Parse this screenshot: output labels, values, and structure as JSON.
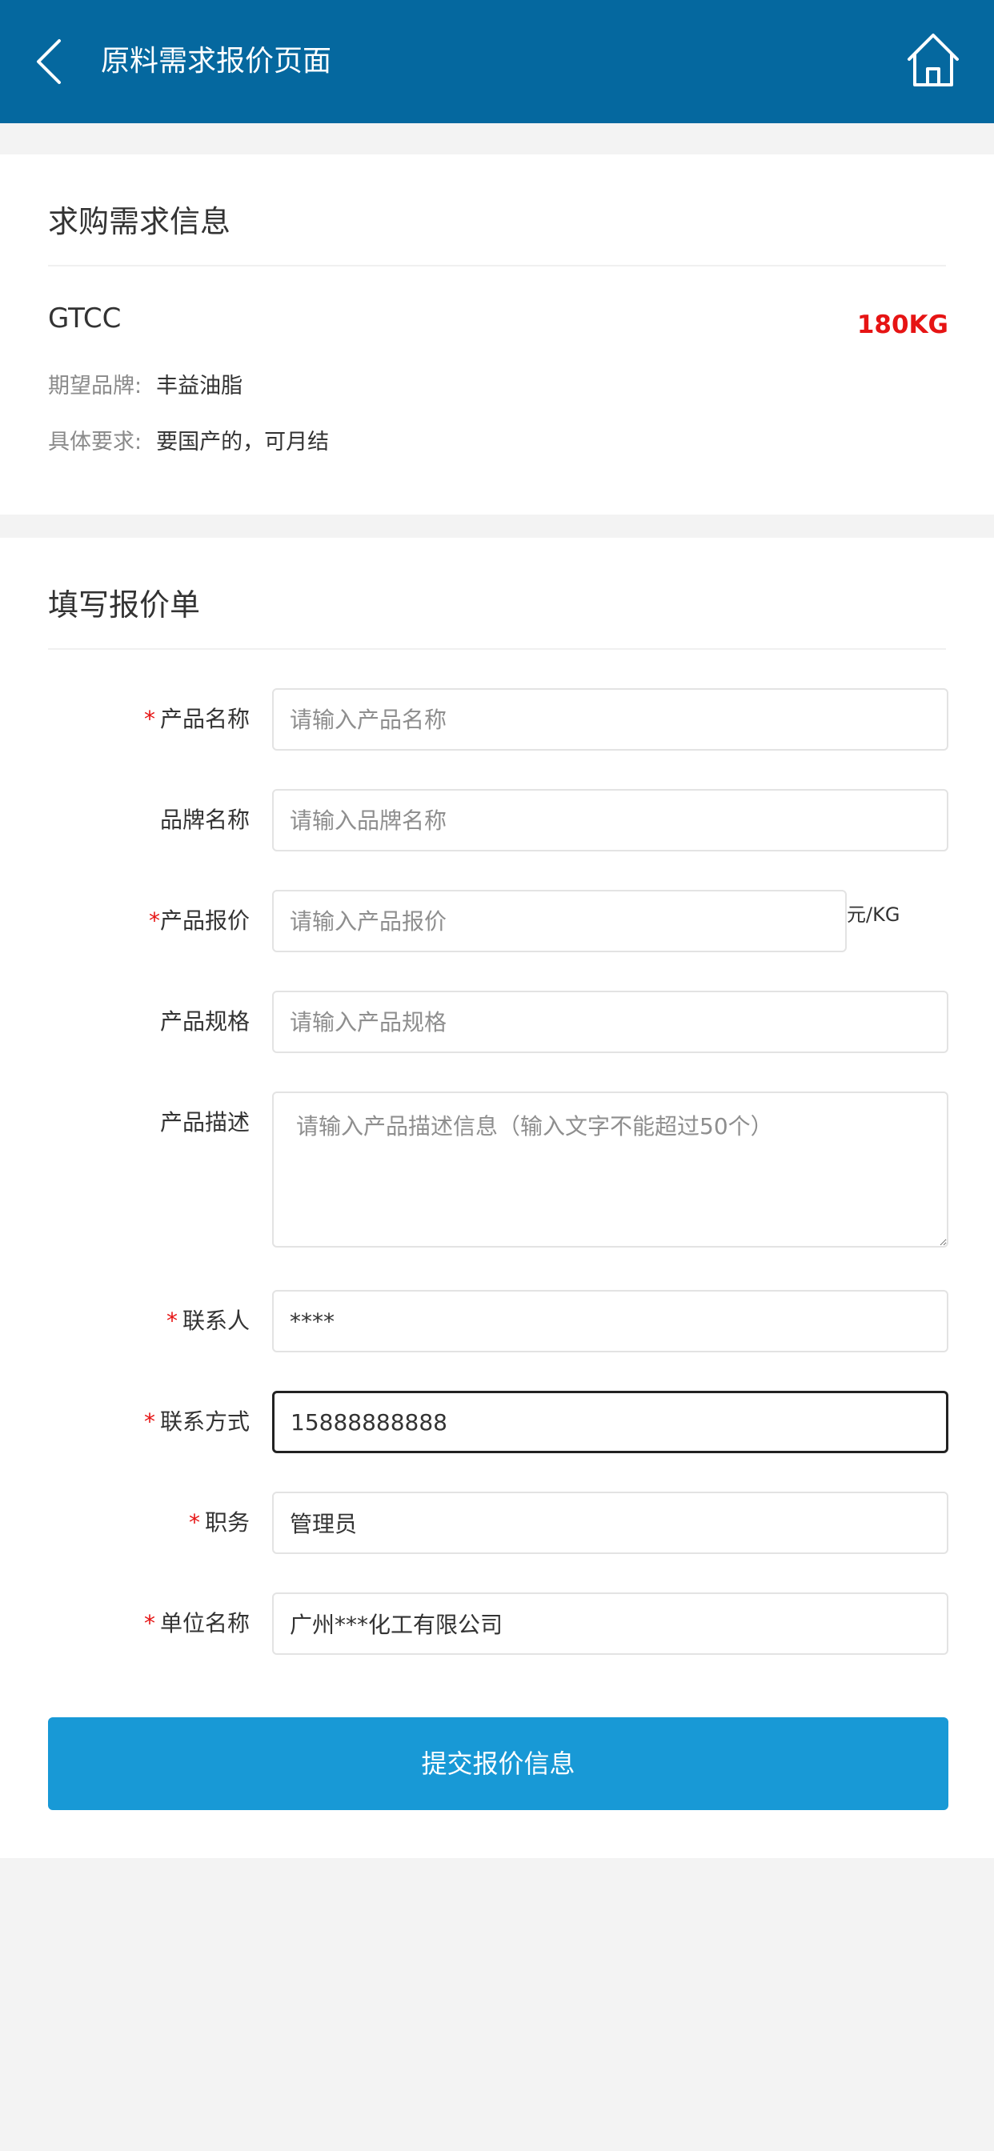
{
  "header": {
    "title": "原料需求报价页面",
    "back_icon": "chevron-left",
    "home_icon": "home",
    "bg_color": "#05689f"
  },
  "demand": {
    "section_title": "求购需求信息",
    "product": "GTCC",
    "quantity": "180KG",
    "quantity_color": "#e61414",
    "brand_label": "期望品牌:",
    "brand_value": "丰益油脂",
    "req_label": "具体要求:",
    "req_value": "要国产的，可月结"
  },
  "form": {
    "section_title": "填写报价单",
    "required_mark": "*",
    "product_name": {
      "label": "产品名称",
      "placeholder": "请输入产品名称",
      "value": ""
    },
    "brand_name": {
      "label": "品牌名称",
      "placeholder": "请输入品牌名称",
      "value": ""
    },
    "price": {
      "label": "产品报价",
      "placeholder": "请输入产品报价",
      "value": "",
      "unit": "元/KG"
    },
    "spec": {
      "label": "产品规格",
      "placeholder": "请输入产品规格",
      "value": ""
    },
    "description": {
      "label": "产品描述",
      "placeholder": "请输入产品描述信息（输入文字不能超过50个）",
      "value": ""
    },
    "contact": {
      "label": "联系人",
      "value": "****"
    },
    "phone": {
      "label": "联系方式",
      "value": "15888888888"
    },
    "position": {
      "label": "职务",
      "value": "管理员"
    },
    "company": {
      "label": "单位名称",
      "value": "广州***化工有限公司"
    },
    "submit_label": "提交报价信息",
    "submit_color": "#1899d6"
  }
}
